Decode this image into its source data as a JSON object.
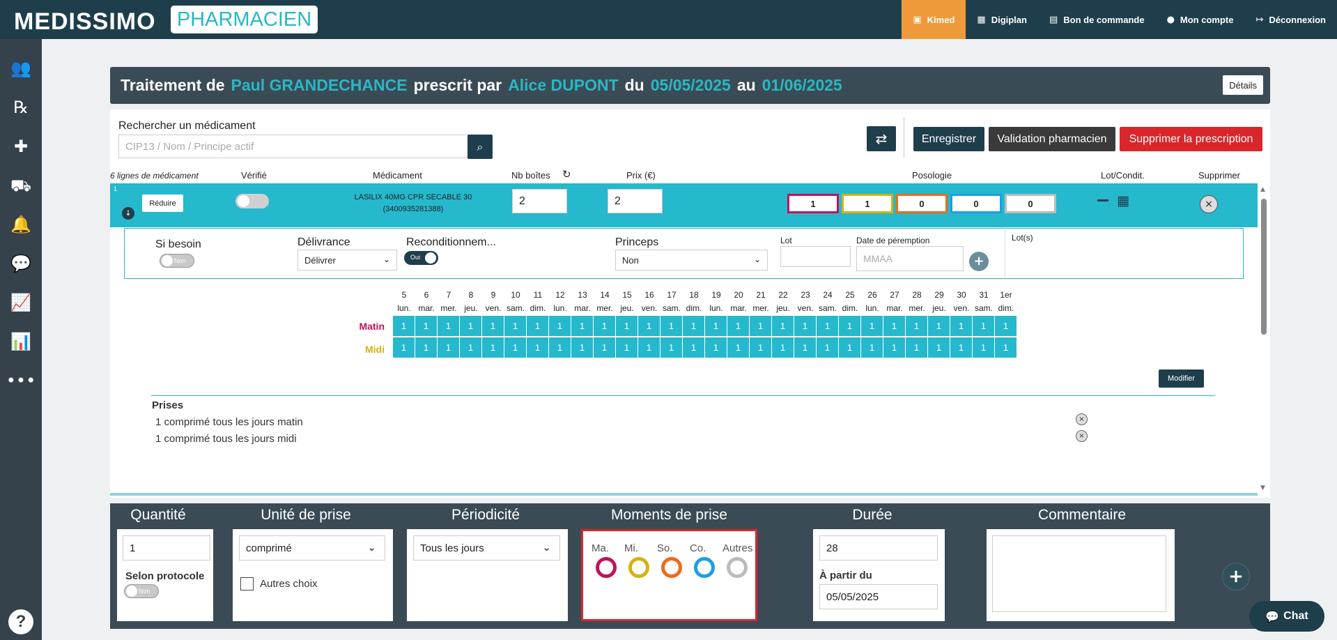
{
  "brand": {
    "name": "MEDISSIMO",
    "product": "PHARMACIEN"
  },
  "topnav": [
    {
      "label": "Kimed",
      "icon": "id-card-icon",
      "active": true
    },
    {
      "label": "Digiplan",
      "icon": "grid-icon",
      "active": false
    },
    {
      "label": "Bon de commande",
      "icon": "box-icon",
      "active": false
    },
    {
      "label": "Mon compte",
      "icon": "user-icon",
      "active": false
    },
    {
      "label": "Déconnexion",
      "icon": "logout-icon",
      "active": false
    }
  ],
  "sidebar_icons": [
    "users-icon",
    "prescription-icon",
    "medical-kit-icon",
    "truck-icon",
    "bell-icon",
    "chat-bubble-icon",
    "line-chart-icon",
    "bar-chart-icon",
    "more-icon"
  ],
  "help": "?",
  "header": {
    "p1": "Traitement de",
    "patient": "Paul GRANDECHANCE",
    "p2": "prescrit par",
    "doctor": "Alice DUPONT",
    "p3": "du",
    "start": "05/05/2025",
    "p4": "au",
    "end": "01/06/2025",
    "details": "Détails"
  },
  "search": {
    "label": "Rechercher un médicament",
    "placeholder": "CIP13 / Nom / Principe actif"
  },
  "actions": {
    "save": "Enregistrer",
    "validate": "Validation pharmacien",
    "delete": "Supprimer la prescription"
  },
  "columns": {
    "lines": "6 lignes de médicament",
    "verified": "Vérifié",
    "medication": "Médicament",
    "boxes": "Nb boîtes",
    "price": "Prix (€)",
    "posology": "Posologie",
    "lot": "Lot/Condit.",
    "remove": "Supprimer"
  },
  "row": {
    "index": "1",
    "reduce": "Réduire",
    "name": "LASILIX 40MG CPR SECABLE 30",
    "code": "(3400935281388)",
    "boxes": "2",
    "price": "2",
    "posology": [
      "1",
      "1",
      "0",
      "0",
      "0"
    ]
  },
  "detail": {
    "si_besoin": "Si besoin",
    "si_besoin_toggle": "Non",
    "delivrance": "Délivrance",
    "delivrance_value": "Délivrer",
    "recond": "Reconditionnem...",
    "recond_toggle": "Oui",
    "princeps": "Princeps",
    "princeps_value": "Non",
    "lot": "Lot",
    "date_peremption": "Date de péremption",
    "date_placeholder": "MMAA",
    "lots": "Lot(s)"
  },
  "calendar": {
    "days": [
      [
        "5",
        "lun."
      ],
      [
        "6",
        "mar."
      ],
      [
        "7",
        "mer."
      ],
      [
        "8",
        "jeu."
      ],
      [
        "9",
        "ven."
      ],
      [
        "10",
        "sam."
      ],
      [
        "11",
        "dim."
      ],
      [
        "12",
        "lun."
      ],
      [
        "13",
        "mar."
      ],
      [
        "14",
        "mer."
      ],
      [
        "15",
        "jeu."
      ],
      [
        "16",
        "ven."
      ],
      [
        "17",
        "sam."
      ],
      [
        "18",
        "dim."
      ],
      [
        "19",
        "lun."
      ],
      [
        "20",
        "mar."
      ],
      [
        "21",
        "mer."
      ],
      [
        "22",
        "jeu."
      ],
      [
        "23",
        "ven."
      ],
      [
        "24",
        "sam."
      ],
      [
        "25",
        "dim."
      ],
      [
        "26",
        "lun."
      ],
      [
        "27",
        "mar."
      ],
      [
        "28",
        "mer."
      ],
      [
        "29",
        "jeu."
      ],
      [
        "30",
        "ven."
      ],
      [
        "31",
        "sam."
      ],
      [
        "1er",
        "dim."
      ]
    ],
    "rows": [
      {
        "label": "Matin",
        "color": "#c0135d",
        "value": "1"
      },
      {
        "label": "Midi",
        "color": "#d8b10e",
        "value": "1"
      }
    ],
    "modify": "Modifier"
  },
  "prises": {
    "title": "Prises",
    "items": [
      "1 comprimé tous les jours matin",
      "1 comprimé tous les jours midi"
    ]
  },
  "form": {
    "quantite": {
      "title": "Quantité",
      "value": "1",
      "protocol": "Selon protocole",
      "toggle": "Non"
    },
    "unite": {
      "title": "Unité de prise",
      "value": "comprimé",
      "other": "Autres choix"
    },
    "periodicite": {
      "title": "Périodicité",
      "value": "Tous les jours"
    },
    "moments": {
      "title": "Moments de prise",
      "items": [
        {
          "label": "Ma.",
          "color": "#c0135d"
        },
        {
          "label": "Mi.",
          "color": "#d8b10e"
        },
        {
          "label": "So.",
          "color": "#ef6a1a"
        },
        {
          "label": "Co.",
          "color": "#1aa0e3"
        },
        {
          "label": "Autres",
          "color": "#bbbbbb"
        }
      ]
    },
    "duree": {
      "title": "Durée",
      "value": "28",
      "from_label": "À partir du",
      "from_value": "05/05/2025"
    },
    "commentaire": {
      "title": "Commentaire",
      "value": ""
    }
  },
  "chat": "Chat"
}
